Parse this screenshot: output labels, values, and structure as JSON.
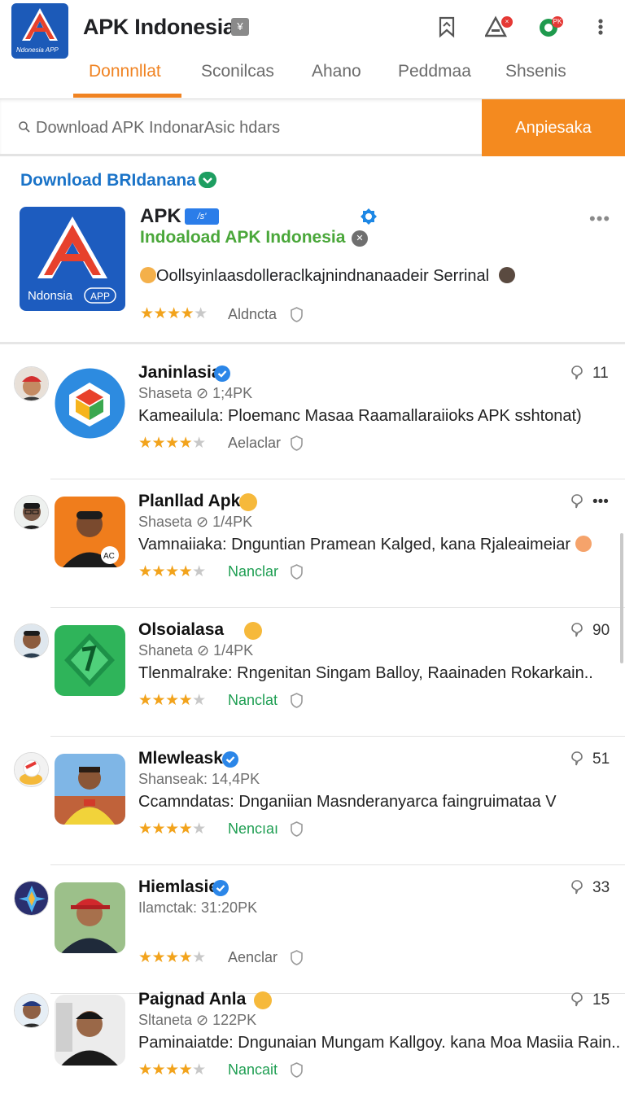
{
  "header": {
    "logo_text": "NIndonesia APP",
    "title": "APK Indonesia",
    "title_badge": "¥",
    "notification_badge": "×",
    "profile_badge": "PK"
  },
  "tabs": [
    {
      "label": "Donnnllat",
      "active": true
    },
    {
      "label": "Sconilcas",
      "active": false
    },
    {
      "label": "Ahano",
      "active": false
    },
    {
      "label": "Peddmaa",
      "active": false
    },
    {
      "label": "Shsenis",
      "active": false
    }
  ],
  "search": {
    "placeholder": "Download APK IndonarAsic hdars",
    "button_label": "Anpiesaka"
  },
  "featured": {
    "section_title": "Download BRIdanana",
    "name": "APK",
    "tag": "/s'",
    "subtitle": "Indoaload APK Indonesia",
    "description": "Oollsyinlaasdolleraclkajnindnanaadeir Serrinal",
    "rating_stars": 4,
    "status": "Aldncta",
    "logo_caption": "Ndonsia",
    "logo_tag": "APP",
    "more": "•••"
  },
  "items": [
    {
      "title": "Janinlasia",
      "verified": true,
      "emoji": false,
      "meta": "Shaseta  ⊘ 1;4PK",
      "desc": "Kameailula: Ploemanc Masaa Raamallaraiioks APK sshtonat)",
      "stars": 4,
      "status": "Aelaclar",
      "status_color": "#666666",
      "count": "11",
      "thumb": "cube",
      "avatar": "red-cap"
    },
    {
      "title": "Planllad Apk",
      "verified": false,
      "emoji": true,
      "meta": "Shaseta  ⊘ 1/4PK",
      "desc": "Vamnaiiaka: Dnguntian Pramean Kalged, kana Rjaleaimeiar",
      "stars": 4,
      "status": "Nanclar",
      "status_color": "#1e9e52",
      "count": "•••",
      "thumb": "person-orange",
      "avatar": "glasses"
    },
    {
      "title": "Olsoialasa",
      "verified": false,
      "emoji": true,
      "meta": "Shaneta  ⊘ 1/4PK",
      "desc": "Tlenmalrake: Rngenitan Singam Balloy, Raainaden Rokarkain..",
      "stars": 4,
      "status": "Nanclat",
      "status_color": "#1e9e52",
      "count": "90",
      "thumb": "green-gem",
      "avatar": "man"
    },
    {
      "title": "Mlewleask",
      "verified": true,
      "emoji": false,
      "meta": "Shanseak:  14,4PK",
      "desc": "Ccamndatas: Dnganiian Masnderanyarca faingruimataa V",
      "stars": 4,
      "status": "Nencıaı",
      "status_color": "#1e9e52",
      "count": "51",
      "thumb": "person-yellow",
      "avatar": "bell"
    },
    {
      "title": "Hiemlasie",
      "verified": true,
      "emoji": false,
      "meta": "Ilamctak:  31:20PK",
      "desc": "",
      "stars": 4,
      "status": "Aenclar",
      "status_color": "#666666",
      "count": "33",
      "thumb": "person-cap",
      "avatar": "star"
    },
    {
      "title": "Paignad Anla",
      "verified": false,
      "emoji": true,
      "meta": "Sltaneta  ⊘ 122PK",
      "desc": "Paminaiatde: Dngunaian Mungam Kallgoy. kana Moa Masiia Rain..",
      "stars": 4,
      "status": "Nancait",
      "status_color": "#1e9e52",
      "count": "15",
      "thumb": "person-black",
      "avatar": "man2"
    }
  ],
  "colors": {
    "accent": "#f08322",
    "link": "#1a73c8",
    "green": "#4aa73a",
    "star": "#f2a31c"
  }
}
